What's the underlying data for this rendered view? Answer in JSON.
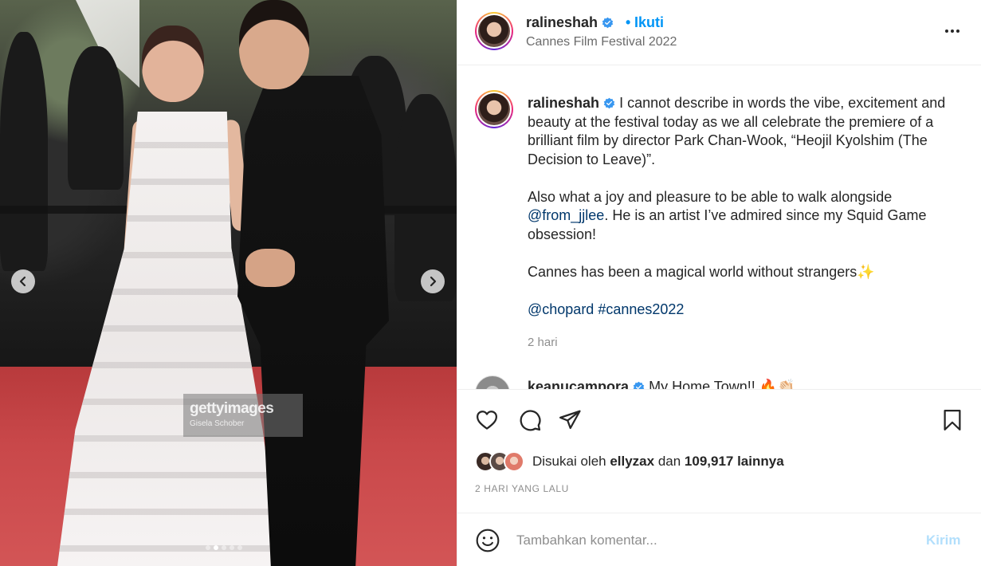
{
  "media": {
    "watermark_logo": "gettyimages",
    "watermark_credit": "Gisela Schober",
    "carousel_dots": 5,
    "active_dot": 1
  },
  "header": {
    "username": "ralineshah",
    "separator": "•",
    "follow_label": "Ikuti",
    "location": "Cannes Film Festival 2022"
  },
  "caption": {
    "username": "ralineshah",
    "line1": "I cannot describe in words the vibe, excitement and beauty at the festival today as we all celebrate the premiere of a brilliant film by director Park Chan-Wook, “Heojil Kyolshim (The Decision to Leave)”.",
    "line2_prefix": "Also what a joy and pleasure to be able to walk alongside ",
    "line2_mention": "@from_jjlee",
    "line2_suffix": ". He is an artist I’ve admired since my Squid Game obsession!",
    "line3": "Cannes has been a magical world without strangers✨",
    "mention_chopard": "@chopard",
    "hashtag": "#cannes2022",
    "time": "2 hari"
  },
  "comment2": {
    "username": "keanucampora",
    "text": "My Home Town!! 🔥👏🏻"
  },
  "likes": {
    "prefix": "Disukai oleh ",
    "user": "ellyzax",
    "middle": " dan ",
    "count": "109,917 lainnya"
  },
  "post_date": "2 HARI YANG LALU",
  "add_comment": {
    "placeholder": "Tambahkan komentar...",
    "post_label": "Kirim"
  },
  "colors": {
    "accent": "#0095f6",
    "link": "#00376b",
    "muted": "#8e8e8e",
    "post_disabled": "#b2dffc"
  },
  "icons": [
    "chevron-left-icon",
    "chevron-right-icon",
    "verified-icon",
    "more-icon",
    "heart-icon",
    "comment-icon",
    "share-icon",
    "bookmark-icon",
    "emoji-icon"
  ]
}
